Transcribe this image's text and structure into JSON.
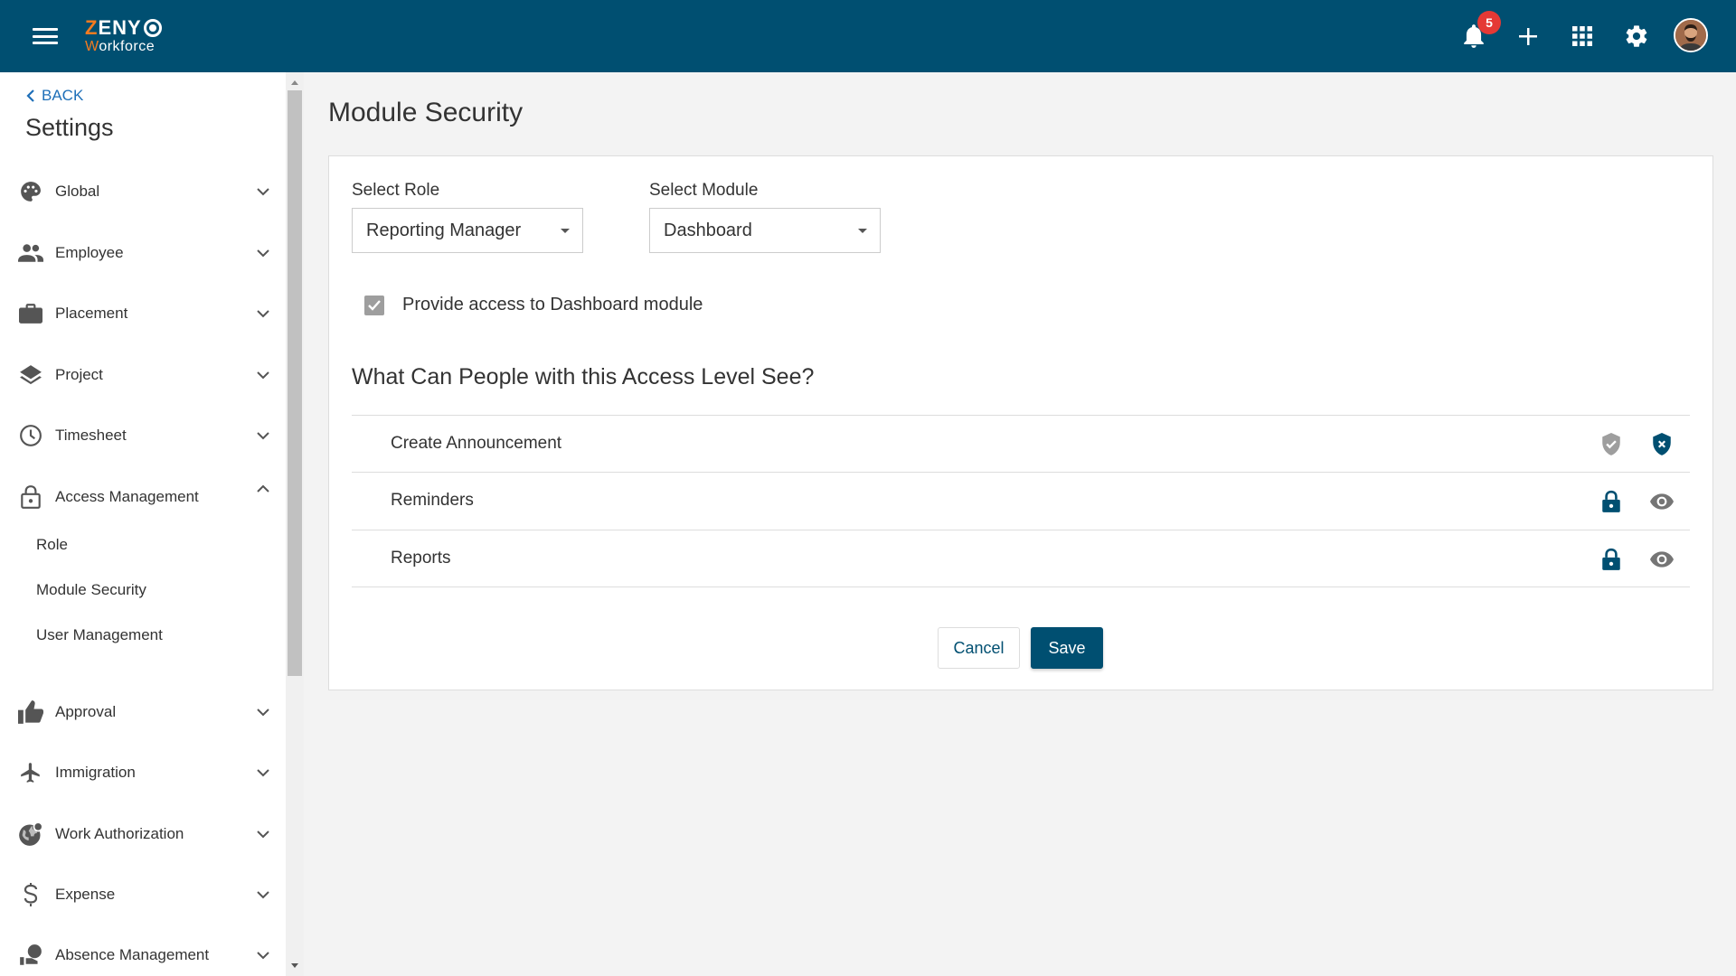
{
  "app": {
    "logo_top_a": "Z",
    "logo_top_b": "ENY",
    "logo_bottom_a": "W",
    "logo_bottom_b": "orkforce",
    "notification_count": "5",
    "brand_color": "#004f71",
    "accent_color": "#f47b20"
  },
  "sidebar": {
    "back_label": "BACK",
    "title": "Settings",
    "items": [
      {
        "label": "Global",
        "icon": "palette-icon"
      },
      {
        "label": "Employee",
        "icon": "people-icon"
      },
      {
        "label": "Placement",
        "icon": "briefcase-icon"
      },
      {
        "label": "Project",
        "icon": "layers-icon"
      },
      {
        "label": "Timesheet",
        "icon": "clock-icon"
      },
      {
        "label": "Access Management",
        "icon": "lock-outline-icon"
      },
      {
        "label": "Approval",
        "icon": "thumbs-up-icon"
      },
      {
        "label": "Immigration",
        "icon": "airplane-icon"
      },
      {
        "label": "Work Authorization",
        "icon": "globe-icon"
      },
      {
        "label": "Expense",
        "icon": "dollar-icon"
      },
      {
        "label": "Absence Management",
        "icon": "person-pin-icon"
      }
    ],
    "subitems": [
      "Role",
      "Module Security",
      "User Management"
    ]
  },
  "main": {
    "page_title": "Module Security",
    "role_label": "Select Role",
    "role_value": "Reporting Manager",
    "module_label": "Select Module",
    "module_value": "Dashboard",
    "access_checkbox_label": "Provide access to Dashboard module",
    "access_checked": true,
    "section_title": "What Can People with this Access Level See?",
    "rows": [
      {
        "label": "Create Announcement",
        "icons": [
          "shield-check-icon",
          "shield-x-icon"
        ]
      },
      {
        "label": "Reminders",
        "icons": [
          "lock-icon",
          "eye-icon"
        ]
      },
      {
        "label": "Reports",
        "icons": [
          "lock-icon",
          "eye-icon"
        ]
      }
    ],
    "cancel_label": "Cancel",
    "save_label": "Save"
  }
}
